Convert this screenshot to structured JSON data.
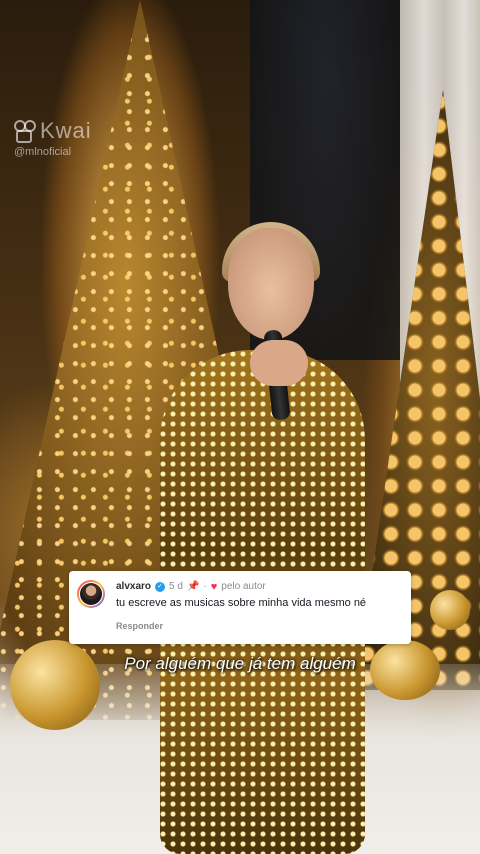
{
  "watermark": {
    "brand": "Kwai",
    "handle": "@mlnoficial"
  },
  "comment": {
    "username": "alvxaro",
    "age": "5 d",
    "author_liked_label": "pelo autor",
    "text": "tu escreve as musicas sobre minha vida mesmo né",
    "reply_label": "Responder"
  },
  "subtitle": "Por alguém que já tem alguém",
  "colors": {
    "like_heart": "#fe2c55",
    "verified_badge": "#20a0ef",
    "muted_text": "#8a8b91"
  },
  "icons": {
    "verified": "verified-badge-icon",
    "pin": "pin-icon",
    "heart": "heart-icon"
  }
}
